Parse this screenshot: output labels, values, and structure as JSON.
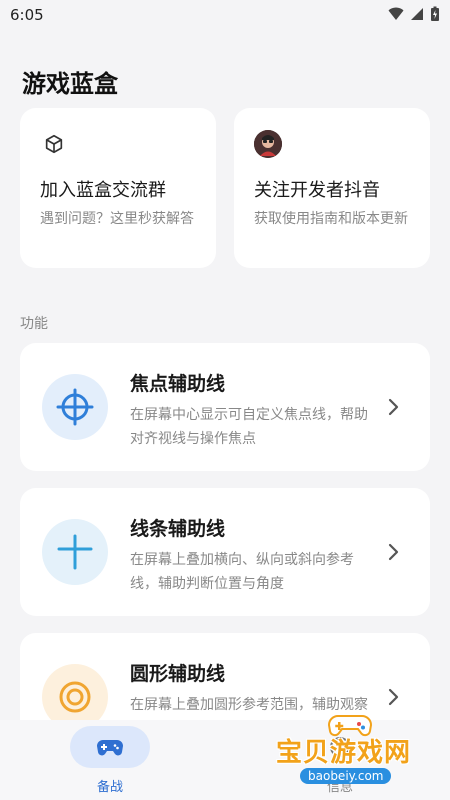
{
  "status_bar": {
    "time": "6:05"
  },
  "app": {
    "title": "游戏蓝盒"
  },
  "top_cards": [
    {
      "title": "加入蓝盒交流群",
      "desc": "遇到问题？这里秒获解答",
      "icon": "cube-icon"
    },
    {
      "title": "关注开发者抖音",
      "desc": "获取使用指南和版本更新",
      "icon": "developer-avatar"
    }
  ],
  "section": {
    "label": "功能"
  },
  "features": [
    {
      "title": "焦点辅助线",
      "desc": "在屏幕中心显示可自定义焦点线，帮助对齐视线与操作焦点",
      "icon": "crosshair-icon",
      "accent": "#2f7fd9",
      "icon_bg": "#e3eefb"
    },
    {
      "title": "线条辅助线",
      "desc": "在屏幕上叠加横向、纵向或斜向参考线，辅助判断位置与角度",
      "icon": "plus-lines-icon",
      "accent": "#2f9fd9",
      "icon_bg": "#e4f1fa"
    },
    {
      "title": "圆形辅助线",
      "desc": "在屏幕上叠加圆形参考范围，辅助观察中心区域与边界",
      "icon": "circle-icon",
      "accent": "#f0a531",
      "icon_bg": "#fdf0dd"
    }
  ],
  "bottom_nav": {
    "items": [
      {
        "label": "备战",
        "icon": "gamepad-icon",
        "active": true
      },
      {
        "label": "信息",
        "icon": "info-icon",
        "active": false
      }
    ]
  },
  "watermark": {
    "text": "宝贝游戏网",
    "url": "baobeiy.com"
  },
  "colors": {
    "accent": "#2f7fd9",
    "background": "#f4f4f6",
    "card": "#ffffff",
    "nav_active_bg": "#dce7fb"
  }
}
